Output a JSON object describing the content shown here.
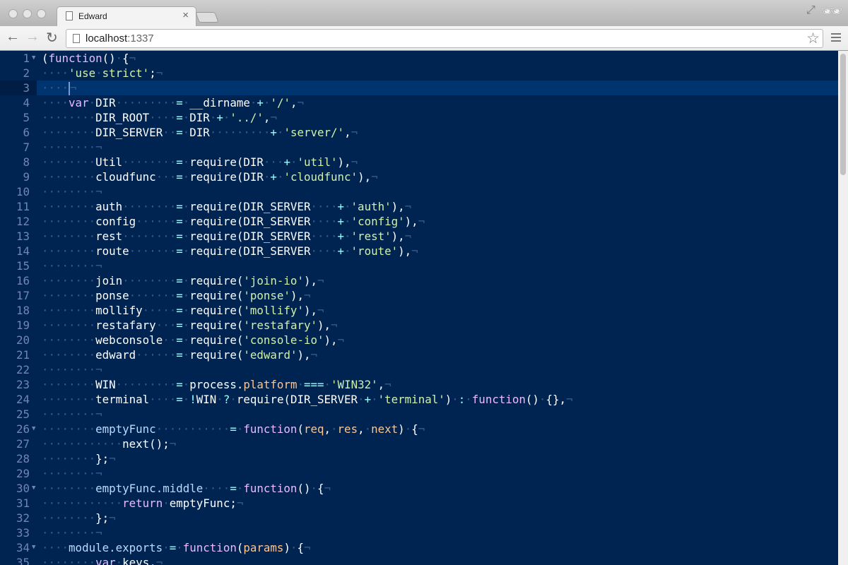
{
  "browser": {
    "tab_title": "Edward",
    "url_host": "localhost",
    "url_port": ":1337"
  },
  "icons": [
    "close-icon",
    "back-icon",
    "forward-icon",
    "reload-icon",
    "page-icon",
    "star-icon",
    "menu-icon",
    "fullscreen-icon",
    "incognito-icon"
  ],
  "theme": {
    "background": "#002451",
    "keyword": "#ebbbff",
    "string": "#d1f1a9",
    "operator": "#99ffff",
    "param": "#ffc58f"
  },
  "editor": {
    "active_line": 3,
    "folds": [
      1,
      26,
      30,
      34
    ],
    "lines": [
      [
        [
          "t",
          "("
        ],
        [
          "k",
          "function"
        ],
        [
          "t",
          "() {"
        ]
      ],
      [
        [
          "t",
          "    "
        ],
        [
          "s",
          "'use strict'"
        ],
        [
          "t",
          ";"
        ]
      ],
      [
        [
          "t",
          "    "
        ]
      ],
      [
        [
          "t",
          "    "
        ],
        [
          "k",
          "var"
        ],
        [
          "t",
          " DIR         "
        ],
        [
          "o",
          "="
        ],
        [
          "t",
          " __dirname "
        ],
        [
          "o",
          "+"
        ],
        [
          "t",
          " "
        ],
        [
          "s",
          "'/'"
        ],
        [
          "t",
          ","
        ]
      ],
      [
        [
          "t",
          "        DIR_ROOT    "
        ],
        [
          "o",
          "="
        ],
        [
          "t",
          " DIR "
        ],
        [
          "o",
          "+"
        ],
        [
          "t",
          " "
        ],
        [
          "s",
          "'../'"
        ],
        [
          "t",
          ","
        ]
      ],
      [
        [
          "t",
          "        DIR_SERVER  "
        ],
        [
          "o",
          "="
        ],
        [
          "t",
          " DIR         "
        ],
        [
          "o",
          "+"
        ],
        [
          "t",
          " "
        ],
        [
          "s",
          "'server/'"
        ],
        [
          "t",
          ","
        ]
      ],
      [
        [
          "t",
          "        "
        ]
      ],
      [
        [
          "t",
          "        Util        "
        ],
        [
          "o",
          "="
        ],
        [
          "t",
          " require(DIR   "
        ],
        [
          "o",
          "+"
        ],
        [
          "t",
          " "
        ],
        [
          "s",
          "'util'"
        ],
        [
          "t",
          "),"
        ]
      ],
      [
        [
          "t",
          "        cloudfunc   "
        ],
        [
          "o",
          "="
        ],
        [
          "t",
          " require(DIR "
        ],
        [
          "o",
          "+"
        ],
        [
          "t",
          " "
        ],
        [
          "s",
          "'cloudfunc'"
        ],
        [
          "t",
          "),"
        ]
      ],
      [
        [
          "t",
          "        "
        ]
      ],
      [
        [
          "t",
          "        auth        "
        ],
        [
          "o",
          "="
        ],
        [
          "t",
          " require(DIR_SERVER    "
        ],
        [
          "o",
          "+"
        ],
        [
          "t",
          " "
        ],
        [
          "s",
          "'auth'"
        ],
        [
          "t",
          "),"
        ]
      ],
      [
        [
          "t",
          "        config      "
        ],
        [
          "o",
          "="
        ],
        [
          "t",
          " require(DIR_SERVER    "
        ],
        [
          "o",
          "+"
        ],
        [
          "t",
          " "
        ],
        [
          "s",
          "'config'"
        ],
        [
          "t",
          "),"
        ]
      ],
      [
        [
          "t",
          "        rest        "
        ],
        [
          "o",
          "="
        ],
        [
          "t",
          " require(DIR_SERVER    "
        ],
        [
          "o",
          "+"
        ],
        [
          "t",
          " "
        ],
        [
          "s",
          "'rest'"
        ],
        [
          "t",
          "),"
        ]
      ],
      [
        [
          "t",
          "        route       "
        ],
        [
          "o",
          "="
        ],
        [
          "t",
          " require(DIR_SERVER    "
        ],
        [
          "o",
          "+"
        ],
        [
          "t",
          " "
        ],
        [
          "s",
          "'route'"
        ],
        [
          "t",
          "),"
        ]
      ],
      [
        [
          "t",
          "        "
        ]
      ],
      [
        [
          "t",
          "        join        "
        ],
        [
          "o",
          "="
        ],
        [
          "t",
          " require("
        ],
        [
          "s",
          "'join-io'"
        ],
        [
          "t",
          "),"
        ]
      ],
      [
        [
          "t",
          "        ponse       "
        ],
        [
          "o",
          "="
        ],
        [
          "t",
          " require("
        ],
        [
          "s",
          "'ponse'"
        ],
        [
          "t",
          "),"
        ]
      ],
      [
        [
          "t",
          "        mollify     "
        ],
        [
          "o",
          "="
        ],
        [
          "t",
          " require("
        ],
        [
          "s",
          "'mollify'"
        ],
        [
          "t",
          "),"
        ]
      ],
      [
        [
          "t",
          "        restafary   "
        ],
        [
          "o",
          "="
        ],
        [
          "t",
          " require("
        ],
        [
          "s",
          "'restafary'"
        ],
        [
          "t",
          "),"
        ]
      ],
      [
        [
          "t",
          "        webconsole  "
        ],
        [
          "o",
          "="
        ],
        [
          "t",
          " require("
        ],
        [
          "s",
          "'console-io'"
        ],
        [
          "t",
          "),"
        ]
      ],
      [
        [
          "t",
          "        edward      "
        ],
        [
          "o",
          "="
        ],
        [
          "t",
          " require("
        ],
        [
          "s",
          "'edward'"
        ],
        [
          "t",
          "),"
        ]
      ],
      [
        [
          "t",
          "        "
        ]
      ],
      [
        [
          "t",
          "        WIN         "
        ],
        [
          "o",
          "="
        ],
        [
          "t",
          " process."
        ],
        [
          "p",
          "platform"
        ],
        [
          "t",
          " "
        ],
        [
          "o",
          "==="
        ],
        [
          "t",
          " "
        ],
        [
          "s",
          "'WIN32'"
        ],
        [
          "t",
          ","
        ]
      ],
      [
        [
          "t",
          "        terminal    "
        ],
        [
          "o",
          "="
        ],
        [
          "t",
          " "
        ],
        [
          "o",
          "!"
        ],
        [
          "t",
          "WIN "
        ],
        [
          "o",
          "?"
        ],
        [
          "t",
          " require(DIR_SERVER "
        ],
        [
          "o",
          "+"
        ],
        [
          "t",
          " "
        ],
        [
          "s",
          "'terminal'"
        ],
        [
          "t",
          ") "
        ],
        [
          "o",
          ":"
        ],
        [
          "t",
          " "
        ],
        [
          "k",
          "function"
        ],
        [
          "t",
          "() {},"
        ]
      ],
      [
        [
          "t",
          "        "
        ]
      ],
      [
        [
          "t",
          "        "
        ],
        [
          "f",
          "emptyFunc"
        ],
        [
          "t",
          "           "
        ],
        [
          "o",
          "="
        ],
        [
          "t",
          " "
        ],
        [
          "k",
          "function"
        ],
        [
          "t",
          "("
        ],
        [
          "p",
          "req"
        ],
        [
          "t",
          ", "
        ],
        [
          "p",
          "res"
        ],
        [
          "t",
          ", "
        ],
        [
          "p",
          "next"
        ],
        [
          "t",
          ") {"
        ]
      ],
      [
        [
          "t",
          "            next();"
        ]
      ],
      [
        [
          "t",
          "        };"
        ]
      ],
      [
        [
          "t",
          "        "
        ]
      ],
      [
        [
          "t",
          "        "
        ],
        [
          "f",
          "emptyFunc.middle"
        ],
        [
          "t",
          "    "
        ],
        [
          "o",
          "="
        ],
        [
          "t",
          " "
        ],
        [
          "k",
          "function"
        ],
        [
          "t",
          "() {"
        ]
      ],
      [
        [
          "t",
          "            "
        ],
        [
          "k",
          "return"
        ],
        [
          "t",
          " emptyFunc;"
        ]
      ],
      [
        [
          "t",
          "        };"
        ]
      ],
      [
        [
          "t",
          "        "
        ]
      ],
      [
        [
          "t",
          "    "
        ],
        [
          "f",
          "module.exports"
        ],
        [
          "t",
          " "
        ],
        [
          "o",
          "="
        ],
        [
          "t",
          " "
        ],
        [
          "k",
          "function"
        ],
        [
          "t",
          "("
        ],
        [
          "p",
          "params"
        ],
        [
          "t",
          ") {"
        ]
      ],
      [
        [
          "t",
          "        "
        ],
        [
          "k",
          "var"
        ],
        [
          "t",
          " keys,"
        ]
      ]
    ]
  }
}
